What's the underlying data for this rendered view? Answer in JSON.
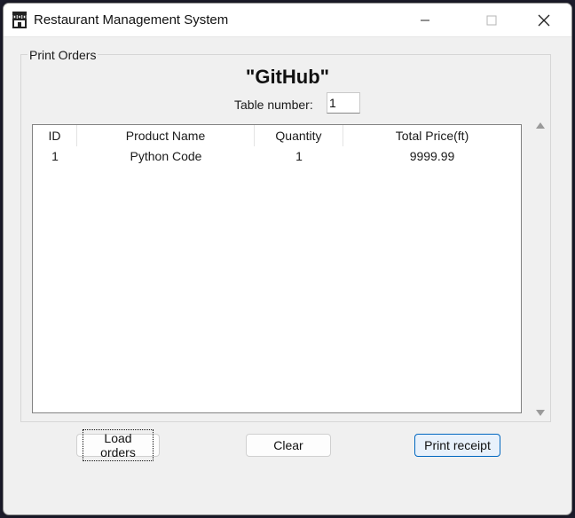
{
  "window": {
    "title": "Restaurant Management System"
  },
  "print_orders": {
    "group_label": "Print Orders",
    "heading": "\"GitHub\"",
    "table_number_label": "Table number:",
    "table_number_value": "1"
  },
  "orders_table": {
    "columns": [
      "ID",
      "Product Name",
      "Quantity",
      "Total Price(ft)"
    ],
    "rows": [
      [
        "1",
        "Python Code",
        "1",
        "9999.99"
      ]
    ]
  },
  "buttons": {
    "load": "Load orders",
    "clear": "Clear",
    "print": "Print receipt"
  },
  "colors": {
    "accent": "#0067c0",
    "window_bg": "#f0f0f0"
  }
}
